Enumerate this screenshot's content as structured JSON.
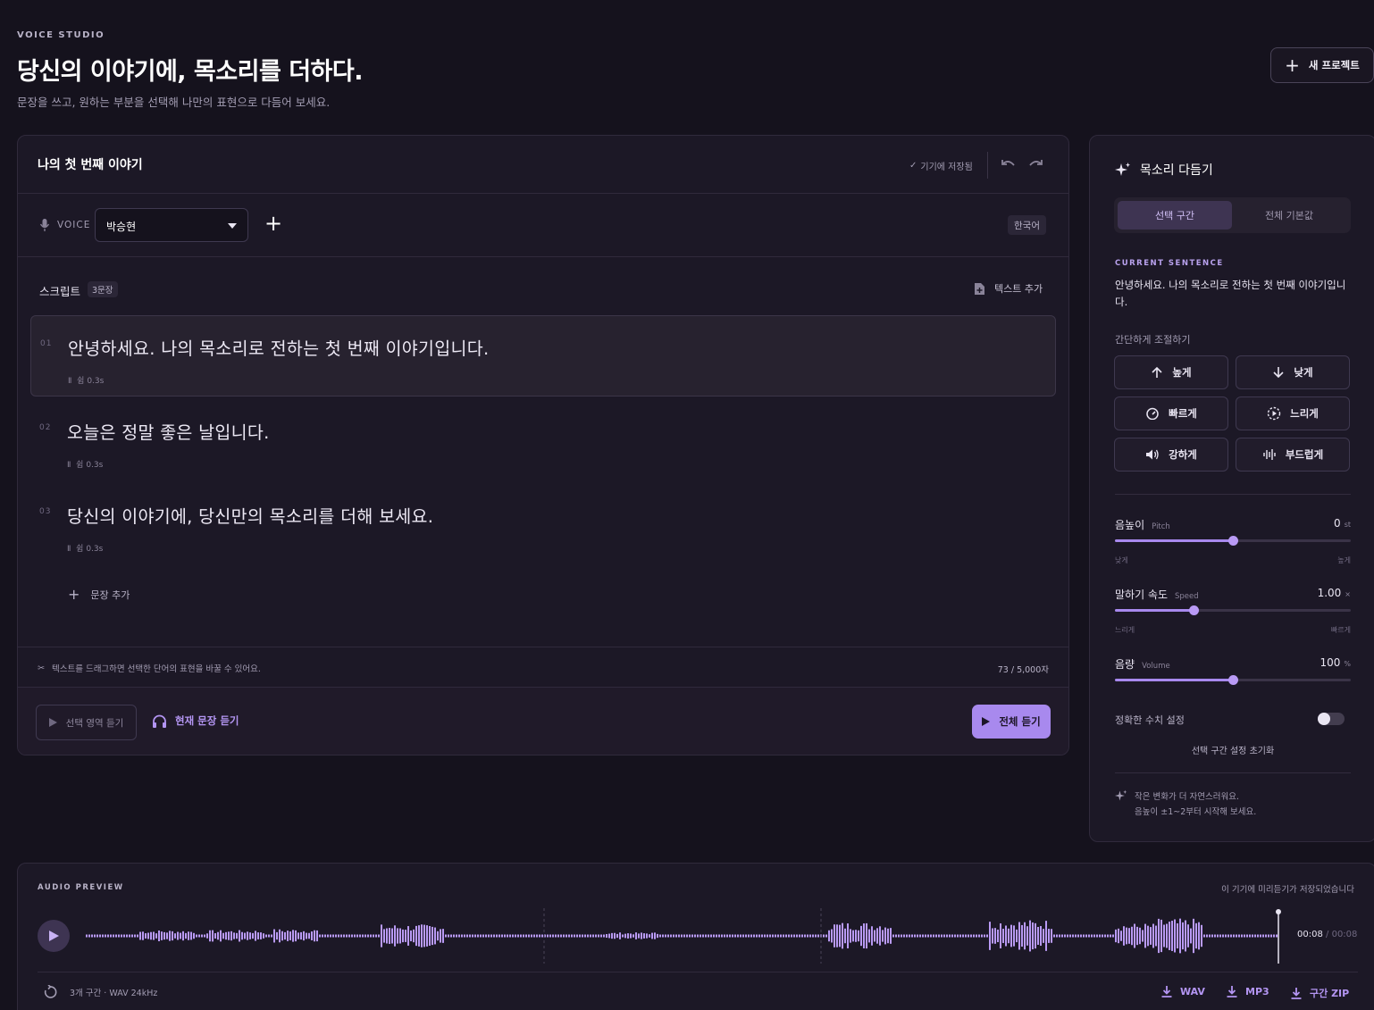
{
  "header": {
    "eyebrow": "VOICE STUDIO",
    "title": "당신의 이야기에, 목소리를 더하다.",
    "subtitle": "문장을 쓰고, 원하는 부분을 선택해 나만의 표현으로 다듬어 보세요.",
    "new_project_label": "새 프로젝트"
  },
  "editor": {
    "title": "나의 첫 번째 이야기",
    "saved_label": "기기에 저장됨",
    "voice_label": "VOICE",
    "voice_selected": "박승현",
    "language_badge": "한국어",
    "script_label": "스크립트",
    "sentence_count": "3문장",
    "add_text_label": "텍스트 추가",
    "sentences": [
      {
        "num": "01",
        "text": "안녕하세요. 나의 목소리로 전하는 첫 번째 이야기입니다.",
        "pause": "쉼 0.3s",
        "active": true
      },
      {
        "num": "02",
        "text": "오늘은 정말 좋은 날입니다.",
        "pause": "쉼 0.3s",
        "active": false
      },
      {
        "num": "03",
        "text": "당신의 이야기에, 당신만의 목소리를 더해 보세요.",
        "pause": "쉼 0.3s",
        "active": false
      }
    ],
    "add_sentence_label": "문장 추가",
    "hint": "텍스트를 드래그하면 선택한 단어의 표현을 바꿀 수 있어요.",
    "char_count": "73 / 5,000자",
    "play_selection_label": "선택 영역 듣기",
    "play_current_label": "현재 문장 듣기",
    "play_all_label": "전체 듣기"
  },
  "panel": {
    "title": "목소리 다듬기",
    "tab_selection": "선택 구간",
    "tab_default": "전체 기본값",
    "current_label": "CURRENT SENTENCE",
    "current_text": "안녕하세요. 나의 목소리로 전하는 첫 번째 이야기입니다.",
    "simple_label": "간단하게 조절하기",
    "quick": {
      "higher": "높게",
      "lower": "낮게",
      "faster": "빠르게",
      "slower": "느리게",
      "stronger": "강하게",
      "softer": "부드럽게"
    },
    "pitch": {
      "label": "음높이",
      "en": "Pitch",
      "value": "0",
      "unit": "st",
      "min_label": "낮게",
      "max_label": "높게",
      "level": 0.5
    },
    "speed": {
      "label": "말하기 속도",
      "en": "Speed",
      "value": "1.00",
      "unit": "×",
      "min_label": "느리게",
      "max_label": "빠르게",
      "level": 0.333
    },
    "volume": {
      "label": "음량",
      "en": "Volume",
      "value": "100",
      "unit": "%",
      "level": 0.5
    },
    "exact_label": "정확한 수치 설정",
    "exact_on": false,
    "reset_label": "선택 구간 설정 초기화",
    "tip_line1": "작은 변화가 더 자연스러워요.",
    "tip_line2": "음높이 ±1~2부터 시작해 보세요."
  },
  "audio": {
    "label": "AUDIO PREVIEW",
    "saved_note": "이 기기에 미리듣기가 저장되었습니다",
    "time_current": "00:08",
    "time_total": "00:08",
    "info": "3개 구간 · WAV 24kHz",
    "download_wav": "WAV",
    "download_mp3": "MP3",
    "download_zip": "구간 ZIP"
  },
  "colors": {
    "accent": "#a889ee",
    "background": "#15121d",
    "card": "#1c1826"
  }
}
